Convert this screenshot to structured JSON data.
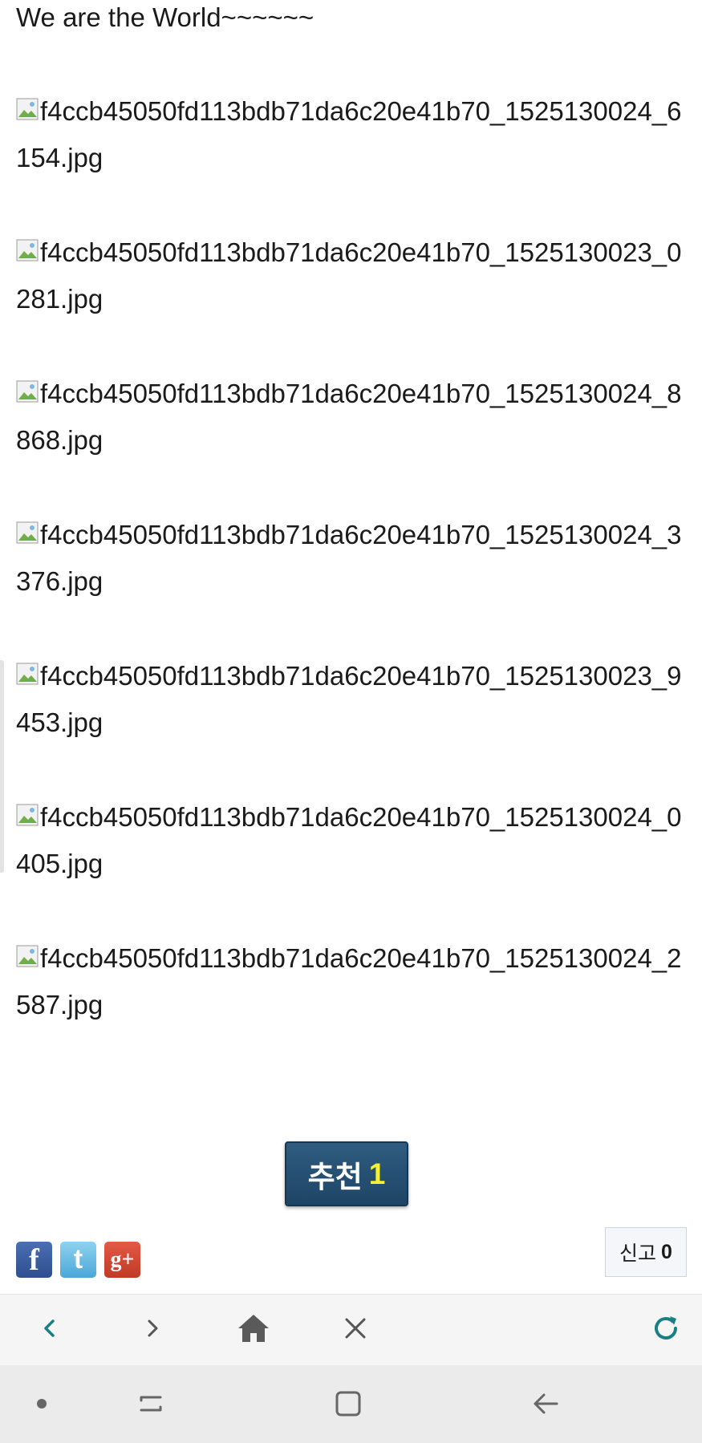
{
  "content": {
    "intro_text": "We are the World~~~~~~",
    "images": [
      {
        "alt": "f4ccb45050fd113bdb71da6c20e41b70_1525130024_6154.jpg"
      },
      {
        "alt": "f4ccb45050fd113bdb71da6c20e41b70_1525130023_0281.jpg"
      },
      {
        "alt": "f4ccb45050fd113bdb71da6c20e41b70_1525130024_8868.jpg"
      },
      {
        "alt": "f4ccb45050fd113bdb71da6c20e41b70_1525130024_3376.jpg"
      },
      {
        "alt": "f4ccb45050fd113bdb71da6c20e41b70_1525130023_9453.jpg"
      },
      {
        "alt": "f4ccb45050fd113bdb71da6c20e41b70_1525130024_0405.jpg"
      },
      {
        "alt": "f4ccb45050fd113bdb71da6c20e41b70_1525130024_2587.jpg"
      }
    ]
  },
  "recommend": {
    "label": "추천",
    "count": "1"
  },
  "share": {
    "facebook_glyph": "f",
    "twitter_glyph": "t",
    "googleplus_glyph": "g+"
  },
  "report": {
    "label": "신고",
    "count": "0"
  },
  "browser_toolbar": {
    "icons": [
      "back-icon",
      "forward-icon",
      "home-icon",
      "close-icon",
      "refresh-icon"
    ],
    "accent_color": "#1a7f85"
  },
  "system_nav": {
    "icons": [
      "dot-icon",
      "recent-apps-icon",
      "home-square-icon",
      "back-arrow-icon"
    ]
  },
  "colors": {
    "recommend_bg": "#2a5476",
    "recommend_count": "#f6f12e",
    "facebook": "#3b5998",
    "twitter": "#55acee",
    "googleplus": "#dd4b39"
  }
}
